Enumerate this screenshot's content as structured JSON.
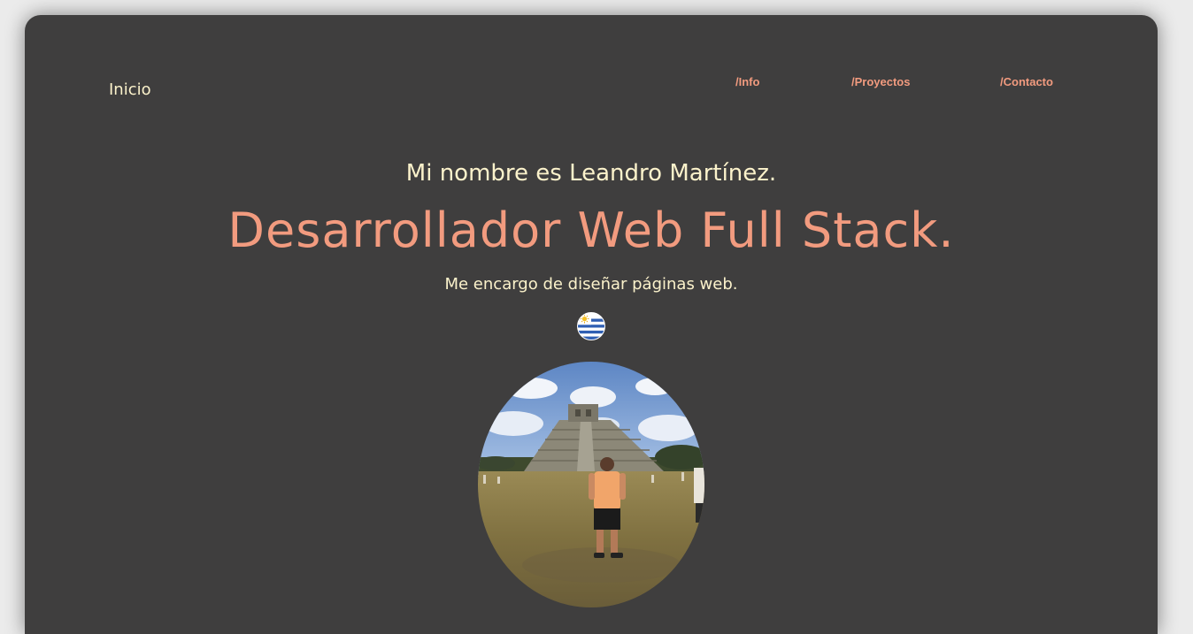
{
  "nav": {
    "brand": "Inicio",
    "links": [
      {
        "label": "/Info"
      },
      {
        "label": "/Proyectos"
      },
      {
        "label": "/Contacto"
      }
    ]
  },
  "hero": {
    "intro": "Mi nombre es Leandro Martínez.",
    "role": "Desarrollador Web Full Stack.",
    "tagline": "Me encargo de diseñar páginas web."
  },
  "icons": {
    "flag": "uruguay-flag-icon",
    "photo": "profile-photo"
  },
  "colors": {
    "background": "#3f3e3e",
    "accent": "#f29b7f",
    "text_light": "#fbf2cb",
    "page": "#ebebeb"
  }
}
